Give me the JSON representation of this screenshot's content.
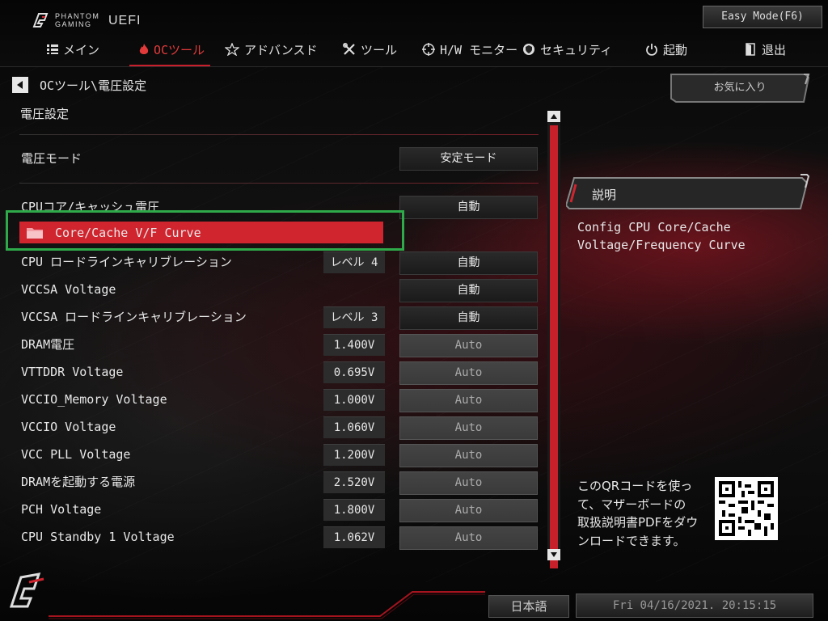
{
  "header": {
    "brand_line1": "PHANTOM",
    "brand_line2": "GAMING",
    "brand_suffix": "UEFI",
    "easy_mode_label": "Easy Mode(F6)"
  },
  "nav": [
    {
      "label": "メイン",
      "icon": "list-icon"
    },
    {
      "label": "OCツール",
      "icon": "flame-icon",
      "active": true
    },
    {
      "label": "アドバンスド",
      "icon": "star-icon"
    },
    {
      "label": "ツール",
      "icon": "tools-icon"
    },
    {
      "label": "H/W モニター",
      "icon": "crosshair-icon"
    },
    {
      "label": "セキュリティ",
      "icon": "shield-icon"
    },
    {
      "label": "起動",
      "icon": "power-icon"
    },
    {
      "label": "退出",
      "icon": "exit-door-icon"
    }
  ],
  "breadcrumb": "OCツール\\電圧設定",
  "favorites_label": "お気に入り",
  "section_title": "電圧設定",
  "voltage_mode": {
    "label": "電圧モード",
    "value": "安定モード"
  },
  "cpu_core_cache": {
    "label": "CPUコア/キャッシュ電圧",
    "value": "自動"
  },
  "selected_item": {
    "label": "Core/Cache V/F Curve",
    "icon": "folder-icon"
  },
  "rows": [
    {
      "label": "CPU ロードラインキャリブレーション",
      "current": "レベル 4",
      "setting": "自動",
      "style": "dark"
    },
    {
      "label": "VCCSA Voltage",
      "current": "",
      "setting": "自動",
      "style": "dark"
    },
    {
      "label": "VCCSA ロードラインキャリブレーション",
      "current": "レベル 3",
      "setting": "自動",
      "style": "dark"
    },
    {
      "label": "DRAM電圧",
      "current": "1.400V",
      "setting": "Auto",
      "style": "auto"
    },
    {
      "label": "VTTDDR Voltage",
      "current": "0.695V",
      "setting": "Auto",
      "style": "auto"
    },
    {
      "label": "VCCIO_Memory Voltage",
      "current": "1.000V",
      "setting": "Auto",
      "style": "auto"
    },
    {
      "label": "VCCIO Voltage",
      "current": "1.060V",
      "setting": "Auto",
      "style": "auto"
    },
    {
      "label": "VCC PLL Voltage",
      "current": "1.200V",
      "setting": "Auto",
      "style": "auto"
    },
    {
      "label": "DRAMを起動する電源",
      "current": "2.520V",
      "setting": "Auto",
      "style": "auto"
    },
    {
      "label": "PCH Voltage",
      "current": "1.800V",
      "setting": "Auto",
      "style": "auto"
    },
    {
      "label": "CPU Standby 1 Voltage",
      "current": "1.062V",
      "setting": "Auto",
      "style": "auto"
    }
  ],
  "description": {
    "heading": "説明",
    "text": "Config CPU Core/Cache\nVoltage/Frequency Curve"
  },
  "qr_text": "このQRコードを使っ\nて、マザーボードの\n取扱説明書PDFをダウ\nンロードできます。",
  "footer": {
    "language": "日本語",
    "datetime": "Fri 04/16/2021. 20:15:15"
  },
  "colors": {
    "accent_red": "#d0252f",
    "highlight_green": "#2faa4a"
  }
}
